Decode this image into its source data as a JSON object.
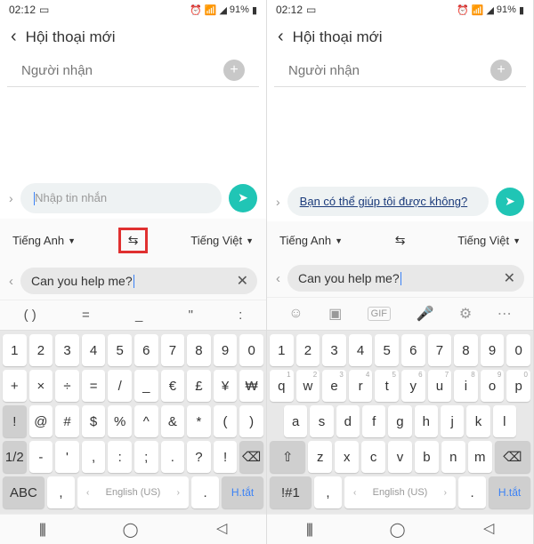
{
  "status": {
    "time": "02:12",
    "battery": "91%"
  },
  "header": {
    "title": "Hội thoại mới"
  },
  "recipient": {
    "placeholder": "Người nhận"
  },
  "left": {
    "compose_placeholder": "Nhập tin nhắn",
    "translate_input": "Can you help me?",
    "suggestions": [
      "( )",
      "=",
      "_",
      "\"",
      ":"
    ]
  },
  "right": {
    "compose_translated": "Bạn có thể giúp tôi được không?",
    "translate_input": "Can you help me?"
  },
  "translate": {
    "lang_from": "Tiếng Anh",
    "lang_to": "Tiếng Việt"
  },
  "kb_left": {
    "r1": [
      "1",
      "2",
      "3",
      "4",
      "5",
      "6",
      "7",
      "8",
      "9",
      "0"
    ],
    "r2": [
      "+",
      "×",
      "÷",
      "=",
      "/",
      "_",
      "€",
      "£",
      "¥",
      "₩"
    ],
    "r3_mid": [
      "@",
      "#",
      "$",
      "%",
      "^",
      "&",
      "*",
      "(",
      ")"
    ]
  },
  "kb_right": {
    "r1": [
      "1",
      "2",
      "3",
      "4",
      "5",
      "6",
      "7",
      "8",
      "9",
      "0"
    ],
    "r2": [
      "q",
      "w",
      "e",
      "r",
      "t",
      "y",
      "u",
      "i",
      "o",
      "p"
    ],
    "r3": [
      "a",
      "s",
      "d",
      "f",
      "g",
      "h",
      "j",
      "k",
      "l"
    ],
    "r4_mid": [
      "z",
      "x",
      "c",
      "v",
      "b",
      "n",
      "m"
    ]
  },
  "bottom": {
    "sym_toggle_left": "1/2",
    "abc_toggle": "ABC",
    "comma": ",",
    "space_lang": "English (US)",
    "period": ".",
    "hint": "H.tắt",
    "sym_toggle_right": "!#1",
    "dash": "-"
  }
}
